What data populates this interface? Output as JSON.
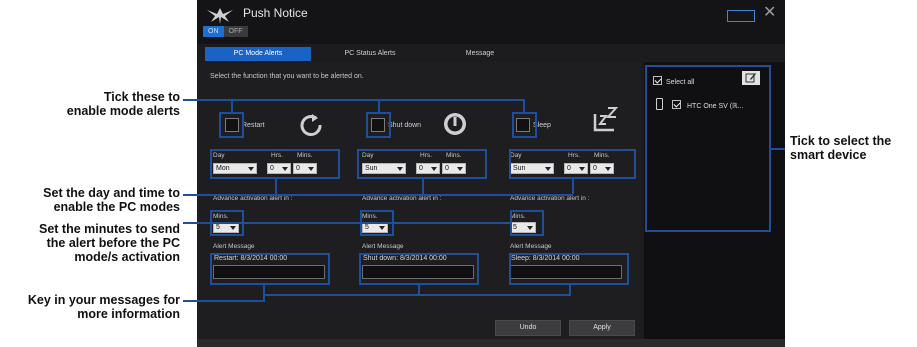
{
  "app": {
    "title": "Push Notice",
    "toggle_on": "ON",
    "toggle_off": "OFF",
    "close_glyph": "✕"
  },
  "tabs": [
    {
      "label": "PC Mode Alerts",
      "active": true
    },
    {
      "label": "PC Status Alerts",
      "active": false
    },
    {
      "label": "Message",
      "active": false
    }
  ],
  "main": {
    "instruction": "Select the function that you want to be alerted on.",
    "modes": [
      {
        "label": "Restart",
        "icon": "restart-icon",
        "day": "Mon",
        "hrs": "0",
        "mins": "0",
        "advance": "5",
        "message": "Restart: 8/3/2014 00:00"
      },
      {
        "label": "Shut down",
        "icon": "power-icon",
        "day": "Sun",
        "hrs": "0",
        "mins": "0",
        "advance": "5",
        "message": "Shut down: 8/3/2014 00:00"
      },
      {
        "label": "Sleep",
        "icon": "sleep-icon",
        "day": "Sun",
        "hrs": "0",
        "mins": "0",
        "advance": "5",
        "message": "Sleep: 8/3/2014 00:00"
      }
    ],
    "labels": {
      "day": "Day",
      "hrs": "Hrs.",
      "mins": "Mins.",
      "advance": "Advance activation alert in :",
      "advance_unit": "Mins.",
      "alert_message": "Alert Message"
    },
    "buttons": {
      "undo": "Undo",
      "apply": "Apply"
    }
  },
  "side": {
    "select_all": "Select all",
    "device": "HTC One SV (ℝ..."
  },
  "annotations": {
    "a1": "Tick these to\nenable mode alerts",
    "a2": "Set the day and time to\nenable the PC modes",
    "a3": "Set the minutes to send\nthe alert before the PC\nmode/s activation",
    "a4": "Key in your messages for\nmore information",
    "a5": "Tick to select the\nsmart device"
  },
  "colors": {
    "accent": "#1a63c6",
    "annotation_line": "#1d4f9c",
    "window_bg": "#1c1c1e"
  }
}
